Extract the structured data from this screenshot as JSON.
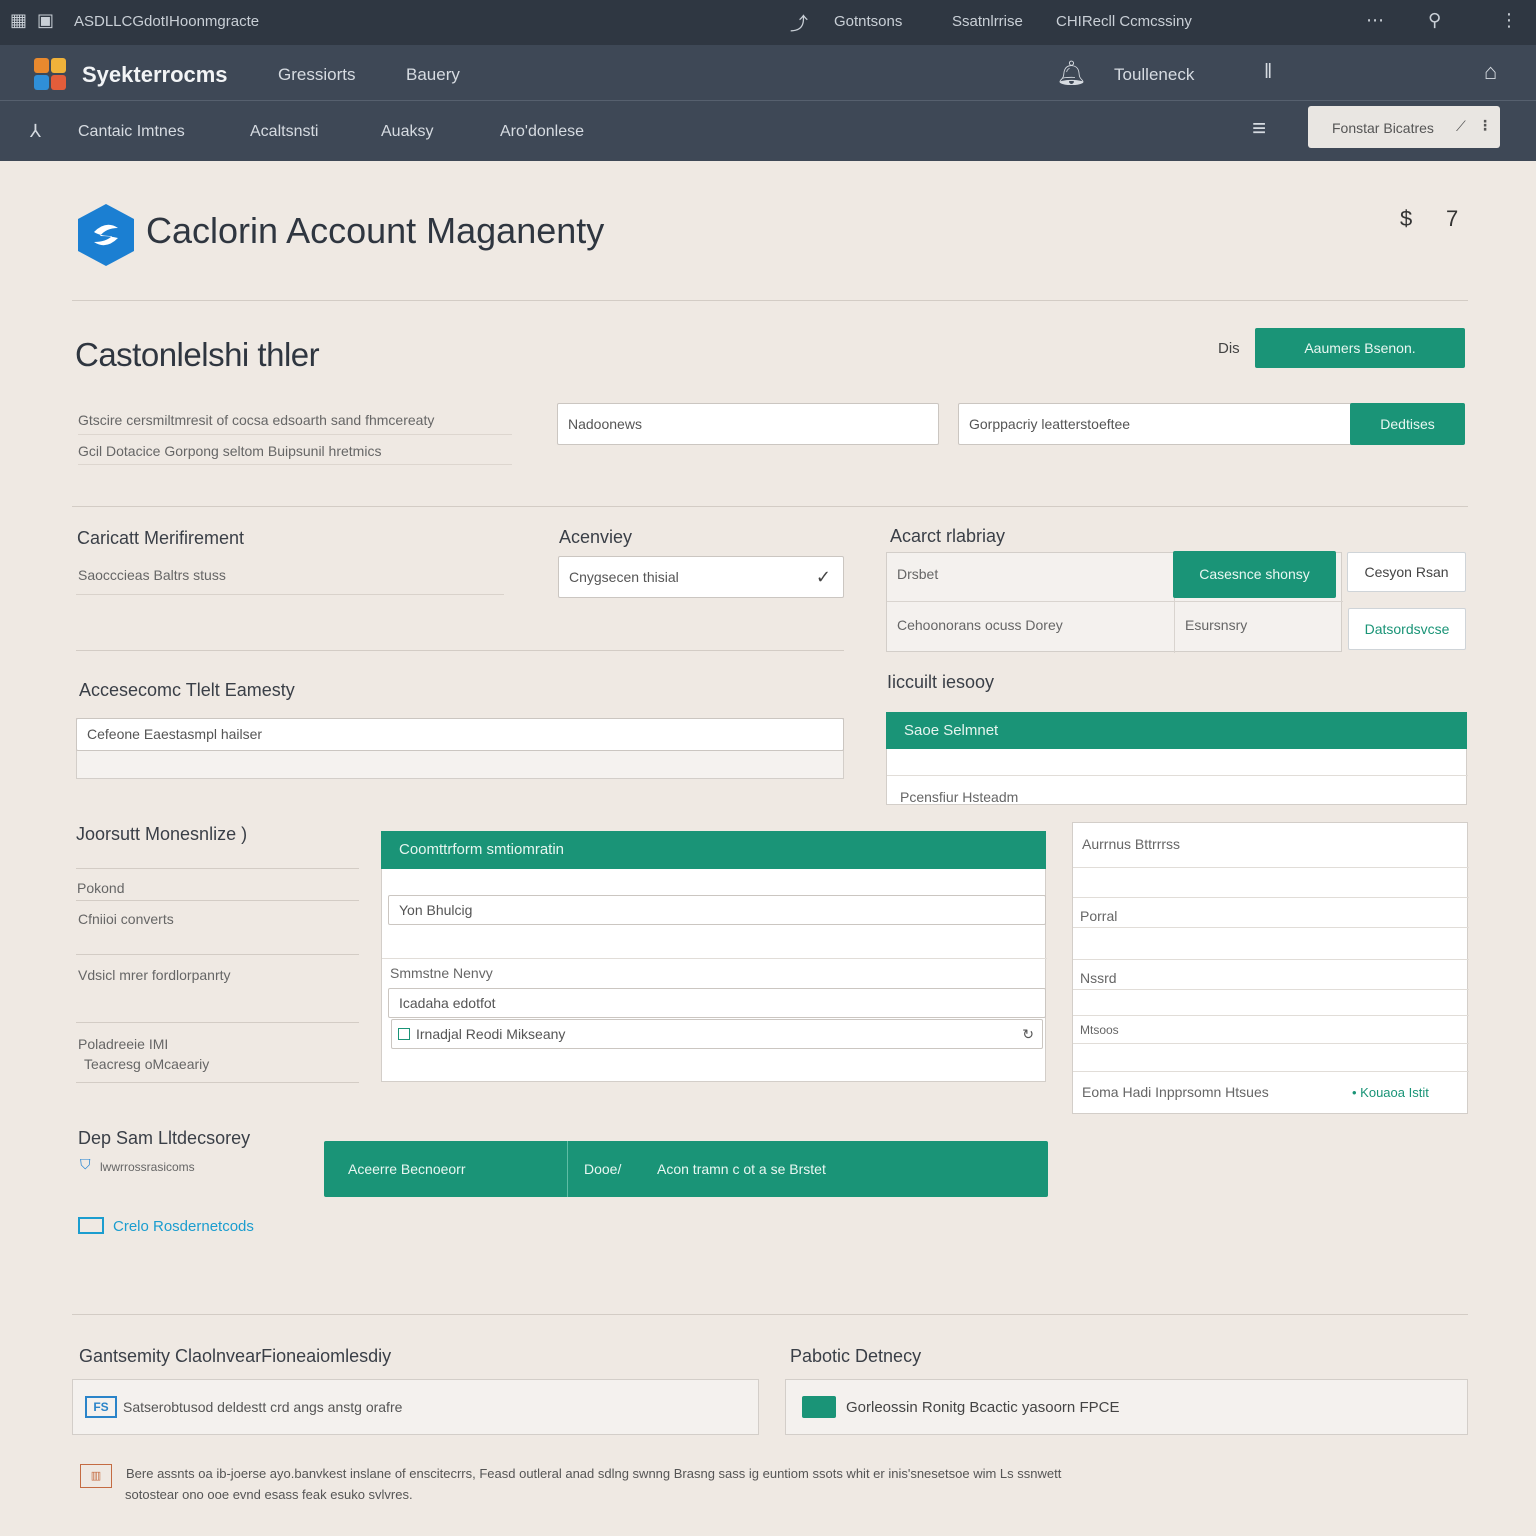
{
  "os_bar": {
    "app_title": "ASDLLCGdotIHoonmgracte",
    "item_1": "Gotntsons",
    "item_2": "Ssatnlrrise",
    "item_3": "CHIRecll Ccmcssiny"
  },
  "app_header": {
    "brand": "Syekterrocms",
    "nav_1": "Gressiorts",
    "nav_2": "Bauery",
    "notify_label": "Toulleneck"
  },
  "nav_bar": {
    "items": [
      "Cantaic Imtnes",
      "Acaltsnsti",
      "Auaksy",
      "Aro'donlese"
    ],
    "select_value": "Fonstar Bicatres"
  },
  "page": {
    "title": "Caclorin Account Maganenty",
    "header_icons": [
      "$",
      "7"
    ]
  },
  "section1": {
    "title": "Castonlelshi thler",
    "dis_label": "Dis",
    "primary_button": "Aaumers Bsenon.",
    "desc_line1": "Gtscire cersmiltmresit of cocsa edsoarth sand fhmcereaty",
    "desc_line2": "Gcil Dotacice Gorpong seltom Buipsunil hretmics",
    "input1_value": "Nadoonews",
    "input2_value": "Gorppacriy leatterstoeftee",
    "input2_button": "Dedtises"
  },
  "section2": {
    "left_title": "Caricatt Merifirement",
    "left_sub": "Saocccieas Baltrs stuss",
    "mid_title": "Acenviey",
    "mid_select": "Cnygsecen thisial",
    "right_title": "Acarct rlabriay",
    "table": [
      {
        "c1": "Drsbet",
        "c2": "Casesnce shonsy",
        "c3": "Cesyon Rsan"
      },
      {
        "c1": "Cehoonorans ocuss Dorey",
        "c2": "Esursnsry",
        "c3": "Datsordsvcse"
      }
    ]
  },
  "section3": {
    "left_title": "Accesecomc Tlelt Eamesty",
    "left_input": "Cefeone Eaestasmpl hailser",
    "right_title": "Iiccuilt iesooy",
    "right_head": "Saoe Selmnet",
    "right_row": "Pcensfiur Hsteadm"
  },
  "section4": {
    "left_title": "Joorsutt Monesnlize )",
    "left_items": [
      "Pokond",
      "Cfniioi converts",
      "Vdsicl mrer fordlorpanrty",
      "Poladreeie IMI",
      "Teacresg oMcaeariy"
    ],
    "center_head": "Coomttrform smtiomratin",
    "center_input1": "Yon Bhulcig",
    "center_label": "Smmstne Nenvy",
    "center_input2": "Icadaha edotfot",
    "center_input3": "Irnadjal Reodi Mikseany",
    "right_head": "Aurrnus Bttrrrss",
    "right_rows": [
      "Porral",
      "Nssrd",
      "Mtsoos"
    ],
    "right_footer": "Eoma Hadi Inpprsomn Htsues",
    "right_link": "• Kouaoa Istit"
  },
  "section5": {
    "title": "Dep Sam Lltdecsorey",
    "sub": "lwwrrossrasicoms",
    "link": "Crelo Rosdernetcods",
    "bar_left": "Aceerre Becnoeorr",
    "bar_mid": "Dooe/",
    "bar_right": "Acon tramn c ot a se Brstet"
  },
  "footer": {
    "left_title": "Gantsemity ClaolnvearFioneaiomlesdiy",
    "right_title": "Pabotic Detnecy",
    "left_box": "Satserobtusod deldestt crd angs anstg orafre",
    "right_box": "Gorleossin Ronitg Bcactic yasoorn FPCE",
    "note_line1": "Bere assnts oa ib-joerse ayo.banvkest inslane of enscitecrrs, Feasd outleral anad sdlng swnng Brasng sass ig euntiom ssots whit er inis'snesetsoe wim Ls ssnwett",
    "note_line2": "sotostear ono ooe evnd esass feak esuko svlvres."
  },
  "colors": {
    "accent": "#1a9477",
    "header_bg": "#3e4856",
    "os_bar_bg": "#2f3742",
    "page_bg": "#efe9e3",
    "logo_blue": "#1b7fd2"
  }
}
